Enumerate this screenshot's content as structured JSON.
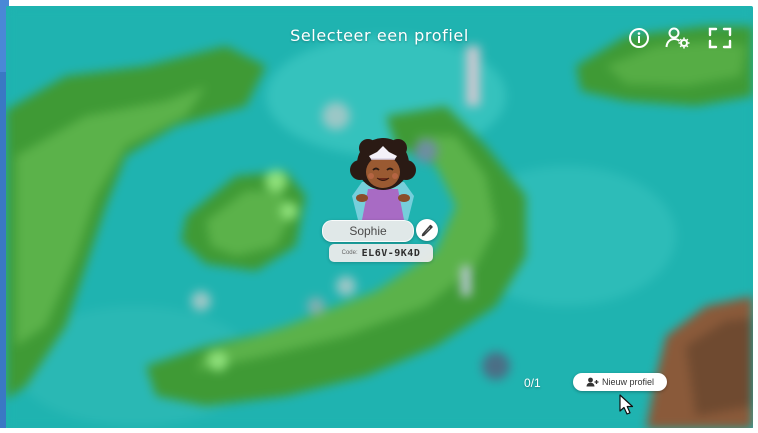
{
  "header": {
    "title": "Selecteer een profiel",
    "icons": [
      "info-icon",
      "user-settings-icon",
      "fullscreen-icon"
    ]
  },
  "profiles": [
    {
      "name": "Sophie",
      "code_label": "Code:",
      "code": "EL6V-9K4D"
    }
  ],
  "footer": {
    "count": "0/1",
    "new_profile_label": "Nieuw profiel"
  },
  "colors": {
    "water": "#1fb3b0",
    "grass": "#3f9a35",
    "soil": "#8a5a3a",
    "frame": "#3a78c4",
    "pill": "#ebebeb"
  }
}
